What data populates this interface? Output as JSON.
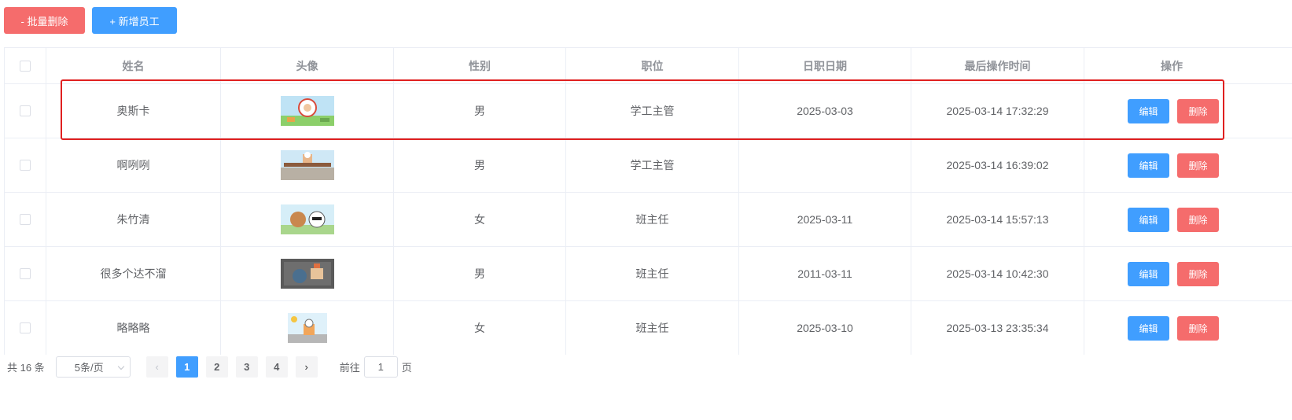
{
  "toolbar": {
    "batch_delete_label": "- 批量删除",
    "add_employee_label": "+ 新增员工"
  },
  "table": {
    "headers": [
      "姓名",
      "头像",
      "性别",
      "职位",
      "日职日期",
      "最后操作时间",
      "操作"
    ],
    "rows": [
      {
        "name": "奥斯卡",
        "gender": "男",
        "position": "学工主管",
        "entry_date": "2025-03-03",
        "last_op": "2025-03-14 17:32:29",
        "avatar": "cartoon-avatar-1"
      },
      {
        "name": "啊咧咧",
        "gender": "男",
        "position": "学工主管",
        "entry_date": "",
        "last_op": "2025-03-14 16:39:02",
        "avatar": "cartoon-avatar-2"
      },
      {
        "name": "朱竹清",
        "gender": "女",
        "position": "班主任",
        "entry_date": "2025-03-11",
        "last_op": "2025-03-14 15:57:13",
        "avatar": "cartoon-avatar-3"
      },
      {
        "name": "很多个达不溜",
        "gender": "男",
        "position": "班主任",
        "entry_date": "2011-03-11",
        "last_op": "2025-03-14 10:42:30",
        "avatar": "cartoon-avatar-4"
      },
      {
        "name": "略略略",
        "gender": "女",
        "position": "班主任",
        "entry_date": "2025-03-10",
        "last_op": "2025-03-13 23:35:34",
        "avatar": "cartoon-avatar-5"
      }
    ],
    "edit_label": "编辑",
    "delete_label": "删除"
  },
  "pagination": {
    "total_text": "共 16 条",
    "page_size": "5条/页",
    "pages": [
      "1",
      "2",
      "3",
      "4"
    ],
    "current_page": "1",
    "goto_prefix": "前往",
    "goto_value": "1",
    "goto_suffix": "页"
  },
  "colors": {
    "primary": "#409eff",
    "danger": "#f56c6c",
    "highlight": "#e02020"
  }
}
